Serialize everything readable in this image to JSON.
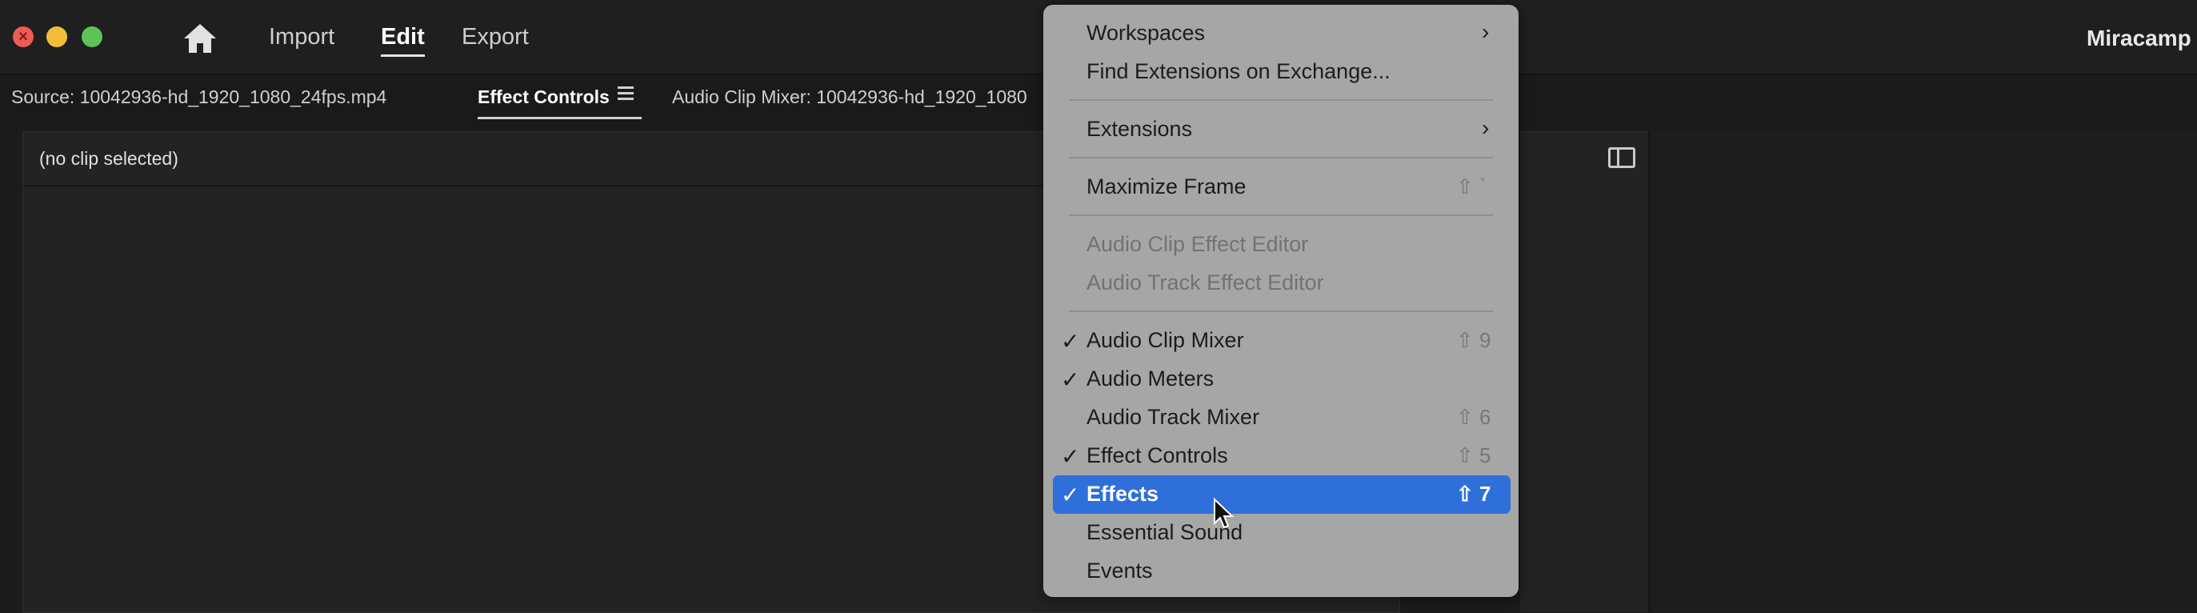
{
  "window": {
    "app_title": "Miracamp I",
    "nav_tabs": [
      {
        "label": "Import",
        "active": false
      },
      {
        "label": "Edit",
        "active": true
      },
      {
        "label": "Export",
        "active": false
      }
    ]
  },
  "panel_tabs": {
    "source": "Source: 10042936-hd_1920_1080_24fps.mp4",
    "effect_controls": "Effect Controls",
    "audio_clip_mixer": "Audio Clip Mixer: 10042936-hd_1920_1080"
  },
  "effect_controls_panel": {
    "no_clip": "(no clip selected)"
  },
  "menu": {
    "items": [
      {
        "label": "Workspaces",
        "submenu": true,
        "enabled": true
      },
      {
        "label": "Find Extensions on Exchange...",
        "enabled": true
      },
      {
        "label": "Extensions",
        "submenu": true,
        "enabled": true
      },
      {
        "label": "Maximize Frame",
        "shortcut": "⇧ `",
        "enabled": true
      },
      {
        "label": "Audio Clip Effect Editor",
        "enabled": false
      },
      {
        "label": "Audio Track Effect Editor",
        "enabled": false
      },
      {
        "label": "Audio Clip Mixer",
        "checked": true,
        "shortcut": "⇧ 9"
      },
      {
        "label": "Audio Meters",
        "checked": true
      },
      {
        "label": "Audio Track Mixer",
        "shortcut": "⇧ 6"
      },
      {
        "label": "Effect Controls",
        "checked": true,
        "shortcut": "⇧ 5"
      },
      {
        "label": "Effects",
        "checked": true,
        "shortcut": "⇧ 7",
        "highlighted": true
      },
      {
        "label": "Essential Sound"
      },
      {
        "label": "Events"
      }
    ],
    "check_glyph": "✓",
    "chevron_glyph": "›",
    "highlight_color": "#2f6fd9"
  },
  "icons": [
    "close-icon",
    "home-icon",
    "hamburger-menu-icon",
    "panel-layout-icon",
    "mouse-cursor-icon"
  ]
}
